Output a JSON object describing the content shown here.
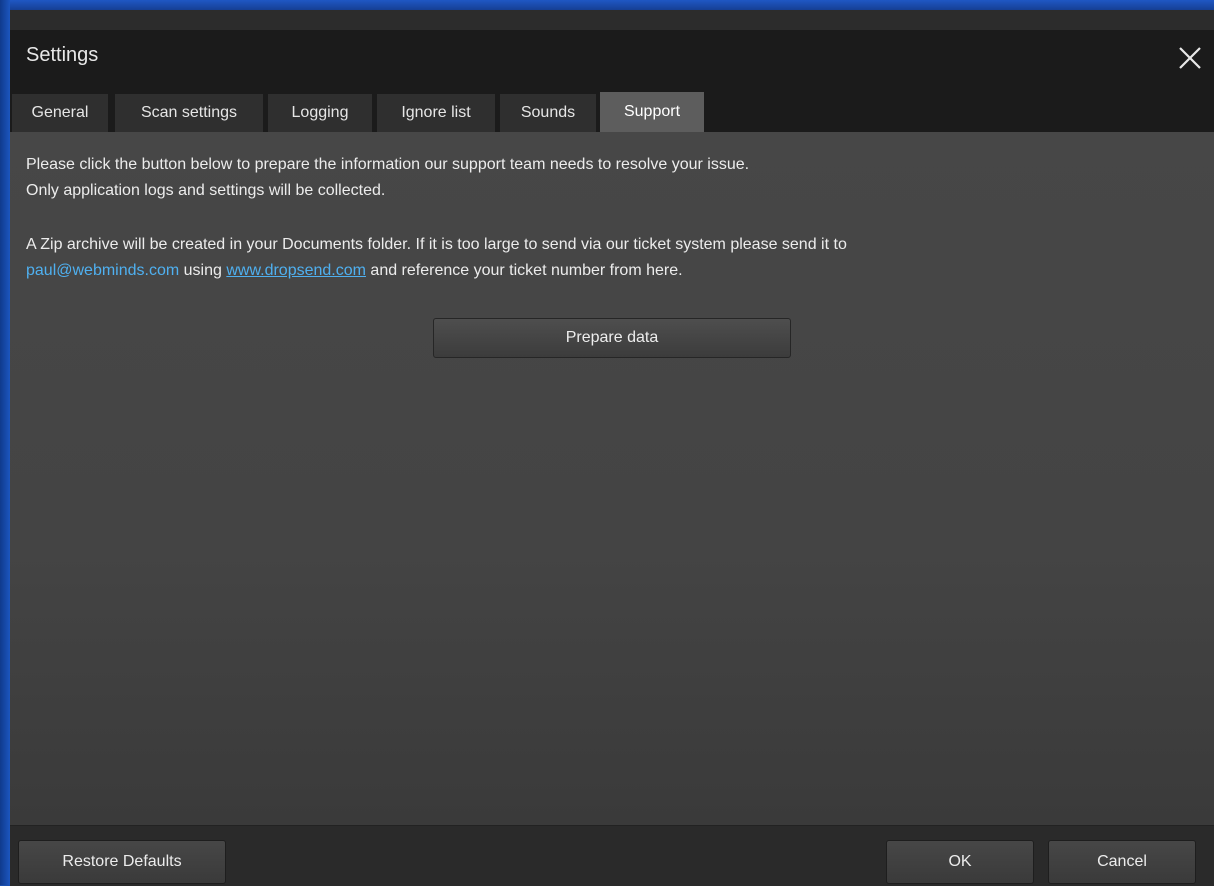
{
  "window": {
    "title": "Settings",
    "close_icon": "close-icon"
  },
  "tabs": [
    {
      "label": "General",
      "active": false
    },
    {
      "label": "Scan settings",
      "active": false
    },
    {
      "label": "Logging",
      "active": false
    },
    {
      "label": "Ignore list",
      "active": false
    },
    {
      "label": "Sounds",
      "active": false
    },
    {
      "label": "Support",
      "active": true
    }
  ],
  "support": {
    "line1": "Please click the button below to prepare the information our support team needs to resolve your issue.",
    "line2": "Only application logs and settings will be collected.",
    "line3": "A Zip archive will be created in your Documents folder. If it is too large to send via our ticket system please send it to",
    "email_link": "paul@webminds.com",
    "using_text": " using ",
    "site_link": "www.dropsend.com",
    "line4_tail": " and reference your ticket number from here.",
    "prepare_button": "Prepare data"
  },
  "footer": {
    "restore_defaults": "Restore Defaults",
    "ok": "OK",
    "cancel": "Cancel"
  },
  "colors": {
    "accent_blue": "#1a4fae",
    "link": "#4fb0f0",
    "active_tab": "#5d5d5d"
  }
}
